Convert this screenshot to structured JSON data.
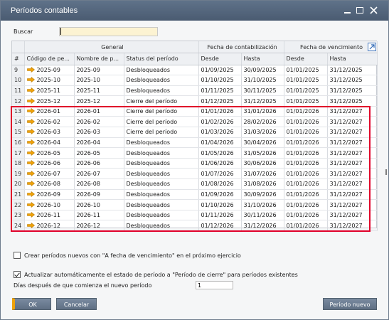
{
  "window": {
    "title": "Períodos contables",
    "controls": {
      "minimize": "_",
      "maximize": "□",
      "close": "✕"
    }
  },
  "search": {
    "label": "Buscar",
    "value": ""
  },
  "table": {
    "group_headers": {
      "general": "General",
      "posting_date": "Fecha de contabilización",
      "due_date": "Fecha de vencimiento"
    },
    "columns": {
      "index": "#",
      "code": "Código de pe...",
      "name": "Nombre de p...",
      "status": "Status del período",
      "post_from": "Desde",
      "post_to": "Hasta",
      "due_from": "Desde",
      "due_to": "Hasta"
    },
    "rows": [
      {
        "n": "9",
        "code": "2025-09",
        "name": "2025-09",
        "status": "Desbloqueados",
        "post_from": "01/09/2025",
        "post_to": "30/09/2025",
        "due_from": "01/01/2025",
        "due_to": "31/12/2025"
      },
      {
        "n": "10",
        "code": "2025-10",
        "name": "2025-10",
        "status": "Desbloqueados",
        "post_from": "01/10/2025",
        "post_to": "31/10/2025",
        "due_from": "01/01/2025",
        "due_to": "31/12/2025"
      },
      {
        "n": "11",
        "code": "2025-11",
        "name": "2025-11",
        "status": "Desbloqueados",
        "post_from": "01/11/2025",
        "post_to": "30/11/2025",
        "due_from": "01/01/2025",
        "due_to": "31/12/2025"
      },
      {
        "n": "12",
        "code": "2025-12",
        "name": "2025-12",
        "status": "Cierre del período",
        "post_from": "01/12/2025",
        "post_to": "31/12/2025",
        "due_from": "01/01/2025",
        "due_to": "31/12/2025"
      },
      {
        "n": "13",
        "code": "2026-01",
        "name": "2026-01",
        "status": "Cierre del período",
        "post_from": "01/01/2026",
        "post_to": "31/01/2026",
        "due_from": "01/01/2026",
        "due_to": "31/12/2027"
      },
      {
        "n": "14",
        "code": "2026-02",
        "name": "2026-02",
        "status": "Cierre del período",
        "post_from": "01/02/2026",
        "post_to": "28/02/2026",
        "due_from": "01/01/2026",
        "due_to": "31/12/2027"
      },
      {
        "n": "15",
        "code": "2026-03",
        "name": "2026-03",
        "status": "Cierre del período",
        "post_from": "01/03/2026",
        "post_to": "31/03/2026",
        "due_from": "01/01/2026",
        "due_to": "31/12/2027"
      },
      {
        "n": "16",
        "code": "2026-04",
        "name": "2026-04",
        "status": "Desbloqueados",
        "post_from": "01/04/2026",
        "post_to": "30/04/2026",
        "due_from": "01/01/2026",
        "due_to": "31/12/2027"
      },
      {
        "n": "17",
        "code": "2026-05",
        "name": "2026-05",
        "status": "Desbloqueados",
        "post_from": "01/05/2026",
        "post_to": "31/05/2026",
        "due_from": "01/01/2026",
        "due_to": "31/12/2027"
      },
      {
        "n": "18",
        "code": "2026-06",
        "name": "2026-06",
        "status": "Desbloqueados",
        "post_from": "01/06/2026",
        "post_to": "30/06/2026",
        "due_from": "01/01/2026",
        "due_to": "31/12/2027"
      },
      {
        "n": "19",
        "code": "2026-07",
        "name": "2026-07",
        "status": "Desbloqueados",
        "post_from": "01/07/2026",
        "post_to": "31/07/2026",
        "due_from": "01/01/2026",
        "due_to": "31/12/2027"
      },
      {
        "n": "20",
        "code": "2026-08",
        "name": "2026-08",
        "status": "Desbloqueados",
        "post_from": "01/08/2026",
        "post_to": "31/08/2026",
        "due_from": "01/01/2026",
        "due_to": "31/12/2027"
      },
      {
        "n": "21",
        "code": "2026-09",
        "name": "2026-09",
        "status": "Desbloqueados",
        "post_from": "01/09/2026",
        "post_to": "30/09/2026",
        "due_from": "01/01/2026",
        "due_to": "31/12/2027"
      },
      {
        "n": "22",
        "code": "2026-10",
        "name": "2026-10",
        "status": "Desbloqueados",
        "post_from": "01/10/2026",
        "post_to": "31/10/2026",
        "due_from": "01/01/2026",
        "due_to": "31/12/2027"
      },
      {
        "n": "23",
        "code": "2026-11",
        "name": "2026-11",
        "status": "Desbloqueados",
        "post_from": "01/11/2026",
        "post_to": "30/11/2026",
        "due_from": "01/01/2026",
        "due_to": "31/12/2027"
      },
      {
        "n": "24",
        "code": "2026-12",
        "name": "2026-12",
        "status": "Desbloqueados",
        "post_from": "01/12/2026",
        "post_to": "31/12/2026",
        "due_from": "01/01/2026",
        "due_to": "31/12/2027"
      }
    ]
  },
  "options": {
    "create_periods_label": "Crear períodos nuevos con \"A fecha de vencimiento\" en el próximo ejercicio",
    "create_periods_checked": false,
    "auto_update_label": "Actualizar automáticamente el estado de período a \"Período de cierre\" para períodos existentes",
    "auto_update_checked": true,
    "days_label": "Días después de que comienza el nuevo período",
    "days_value": "1"
  },
  "buttons": {
    "ok": "OK",
    "cancel": "Cancelar",
    "new_period": "Período nuevo"
  },
  "colors": {
    "titlebar": "#4f6178",
    "highlight": "#e0002a",
    "arrow": "#f0a30a",
    "search_bg": "#fcf3d2"
  },
  "icons": {
    "row_link": "link-arrow-icon",
    "expand": "expand-arrow-icon"
  }
}
